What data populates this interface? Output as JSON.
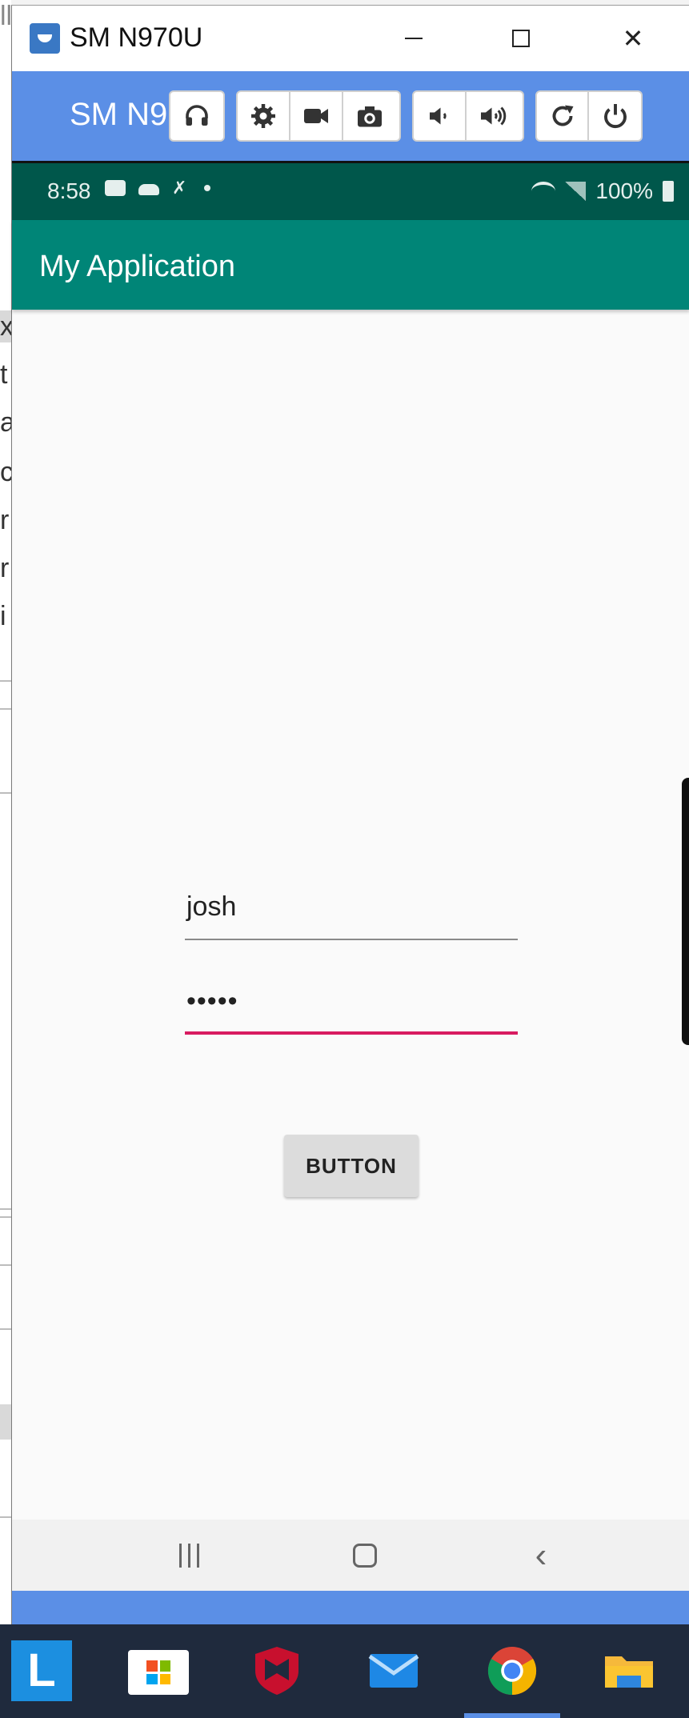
{
  "window": {
    "title": "SM N970U"
  },
  "control_bar": {
    "title": "SM N970U",
    "buttons": [
      "headphones-icon",
      "settings-icon",
      "video-icon",
      "camera-icon",
      "volume-down-icon",
      "volume-up-icon",
      "rotate-icon",
      "power-icon"
    ]
  },
  "status_bar": {
    "time": "8:58",
    "battery": "100%"
  },
  "app": {
    "toolbar_title": "My Application",
    "username_value": "josh",
    "password_value": "•••••",
    "button_label": "BUTTON"
  },
  "colors": {
    "control_bar": "#5b8fe6",
    "status_bar": "#00574b",
    "toolbar": "#008577",
    "password_underline": "#d81b60"
  },
  "taskbar": {
    "apps": [
      "launcher-icon",
      "microsoft-store-icon",
      "mcafee-icon",
      "mail-icon",
      "chrome-icon",
      "file-explorer-icon"
    ]
  }
}
